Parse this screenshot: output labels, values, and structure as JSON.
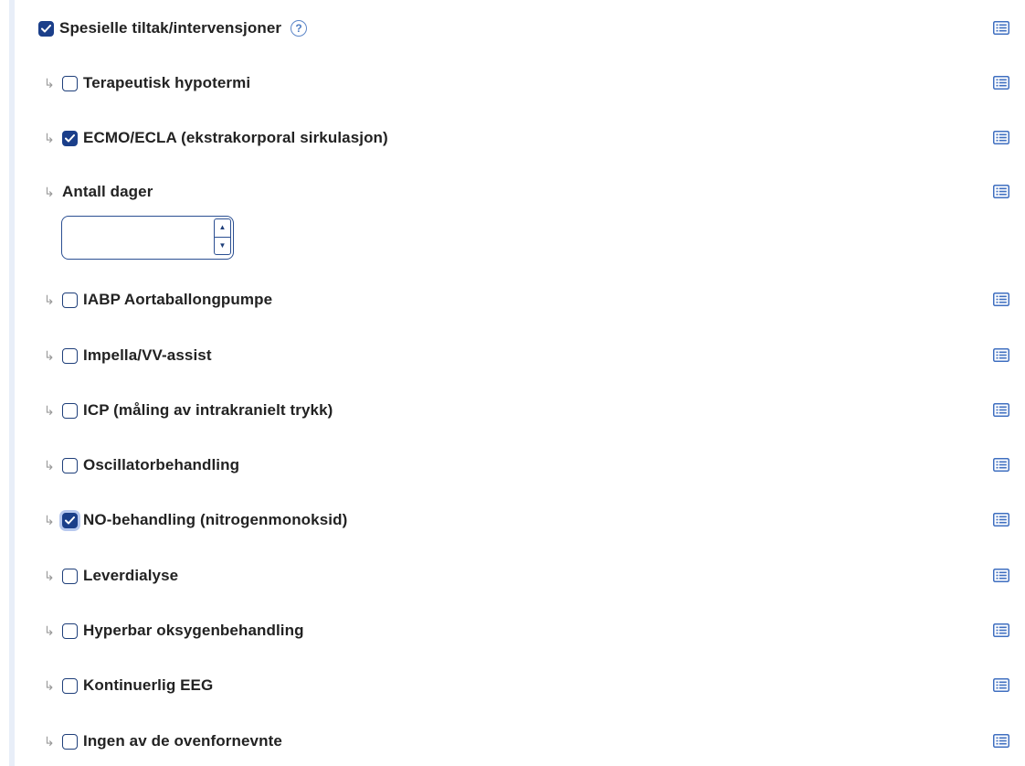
{
  "section": {
    "label": "Spesielle tiltak/intervensjoner",
    "checked": true,
    "help_icon": "?"
  },
  "items": [
    {
      "label": "Terapeutisk hypotermi",
      "checked": false
    },
    {
      "label": "ECMO/ECLA (ekstrakorporal sirkulasjon)",
      "checked": true
    },
    {
      "label": "Antall dager",
      "type": "number",
      "value": ""
    },
    {
      "label": "IABP Aortaballongpumpe",
      "checked": false
    },
    {
      "label": "Impella/VV-assist",
      "checked": false
    },
    {
      "label": "ICP (måling av intrakranielt trykk)",
      "checked": false
    },
    {
      "label": "Oscillatorbehandling",
      "checked": false
    },
    {
      "label": "NO-behandling (nitrogenmonoksid)",
      "checked": true,
      "focused": true
    },
    {
      "label": "Leverdialyse",
      "checked": false
    },
    {
      "label": "Hyperbar oksygenbehandling",
      "checked": false
    },
    {
      "label": "Kontinuerlig EEG",
      "checked": false
    },
    {
      "label": "Ingen av de ovenfornevnte",
      "checked": false
    }
  ],
  "spinner": {
    "up": "▲",
    "down": "▼"
  },
  "sub_arrow": "↳",
  "colors": {
    "checkbox_checked": "#1b3f8a",
    "checkbox_border": "#1f3f7a",
    "list_icon": "#3f6fc0",
    "rail": "#e8eef8"
  }
}
